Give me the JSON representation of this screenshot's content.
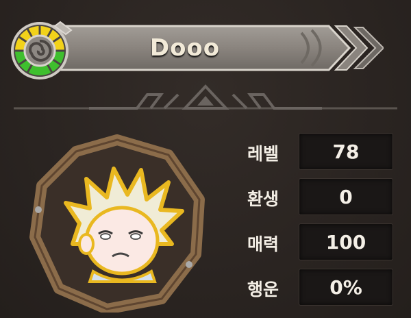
{
  "profile": {
    "name": "Dooo"
  },
  "stats": [
    {
      "label": "레벨",
      "value": "78"
    },
    {
      "label": "환생",
      "value": "0"
    },
    {
      "label": "매력",
      "value": "100"
    },
    {
      "label": "행운",
      "value": "0%"
    }
  ],
  "icons": {
    "emblem": "rank-emblem-icon",
    "portrait": "character-portrait"
  },
  "colors": {
    "banner": "#8a8580",
    "emblem_yellow": "#f2d21a",
    "emblem_green": "#3fbf2e",
    "frame": "#8b6c4a"
  }
}
